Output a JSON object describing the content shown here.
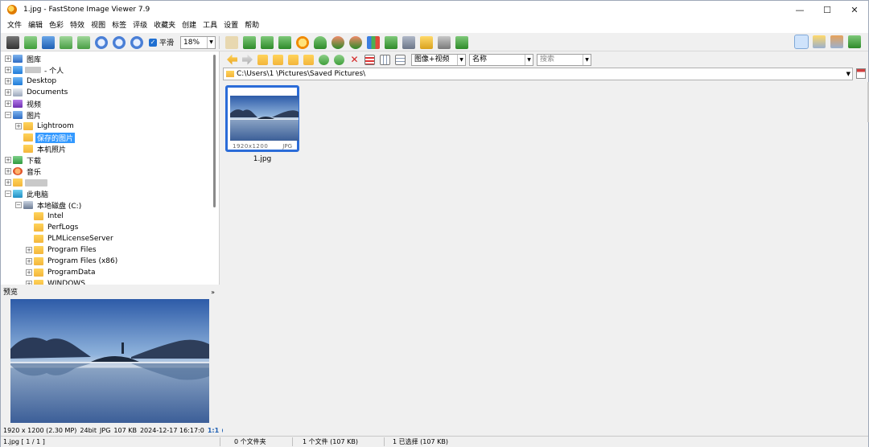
{
  "window": {
    "title": "1.jpg  -  FastStone Image Viewer 7.9",
    "controls": {
      "minimize": "—",
      "maximize": "☐",
      "close": "✕"
    }
  },
  "menu": [
    "文件",
    "编辑",
    "色彩",
    "特效",
    "视图",
    "标签",
    "评级",
    "收藏夹",
    "创建",
    "工具",
    "设置",
    "帮助"
  ],
  "toolbar": {
    "smooth_label": "平滑",
    "smooth_checked": true,
    "zoom_value": "18%",
    "icons": [
      "camera-icon",
      "open-folder-icon",
      "save-icon",
      "prev-image-icon",
      "next-image-icon",
      "zoom-in-icon",
      "zoom-out-icon",
      "actual-size-icon"
    ],
    "tools_icons": [
      "hand-tool-icon",
      "crop-icon",
      "resize-icon",
      "canvas-icon",
      "color-adjust-icon",
      "red-eye-icon",
      "rotate-left-icon",
      "rotate-right-icon",
      "histogram-icon",
      "slideshow-icon",
      "draw-icon",
      "email-icon",
      "print-icon",
      "checkmark-icon"
    ],
    "view_icons": [
      "thumbnail-view-icon",
      "detail-view-icon",
      "single-view-icon",
      "fullscreen-icon"
    ]
  },
  "tree": {
    "items": [
      {
        "label": "图库",
        "indent": 0,
        "expander": "+",
        "icon": "gallery-icon"
      },
      {
        "label": "- 个人",
        "indent": 0,
        "expander": "+",
        "icon": "onedrive-icon",
        "blurred_prefix": true
      },
      {
        "label": "Desktop",
        "indent": 0,
        "expander": "+",
        "icon": "desktop-icon"
      },
      {
        "label": "Documents",
        "indent": 0,
        "expander": "+",
        "icon": "documents-icon"
      },
      {
        "label": "视频",
        "indent": 0,
        "expander": "+",
        "icon": "videos-icon"
      },
      {
        "label": "图片",
        "indent": 0,
        "expander": "−",
        "icon": "pictures-icon"
      },
      {
        "label": "Lightroom",
        "indent": 1,
        "expander": "+",
        "icon": "folder-icon"
      },
      {
        "label": "保存的图片",
        "indent": 1,
        "expander": "",
        "icon": "folder-icon",
        "selected": true
      },
      {
        "label": "本机照片",
        "indent": 1,
        "expander": "",
        "icon": "folder-icon"
      },
      {
        "label": "下载",
        "indent": 0,
        "expander": "+",
        "icon": "downloads-icon"
      },
      {
        "label": "音乐",
        "indent": 0,
        "expander": "+",
        "icon": "music-icon"
      },
      {
        "label": "",
        "indent": 0,
        "expander": "+",
        "icon": "folder-icon",
        "blurred": true
      },
      {
        "label": "此电脑",
        "indent": 0,
        "expander": "−",
        "icon": "this-pc-icon"
      },
      {
        "label": "本地磁盘 (C:)",
        "indent": 1,
        "expander": "−",
        "icon": "drive-icon"
      },
      {
        "label": "Intel",
        "indent": 2,
        "expander": "",
        "icon": "folder-icon"
      },
      {
        "label": "PerfLogs",
        "indent": 2,
        "expander": "",
        "icon": "folder-icon"
      },
      {
        "label": "PLMLicenseServer",
        "indent": 2,
        "expander": "",
        "icon": "folder-icon"
      },
      {
        "label": "Program Files",
        "indent": 2,
        "expander": "+",
        "icon": "folder-icon"
      },
      {
        "label": "Program Files (x86)",
        "indent": 2,
        "expander": "+",
        "icon": "folder-icon"
      },
      {
        "label": "ProgramData",
        "indent": 2,
        "expander": "+",
        "icon": "folder-icon"
      },
      {
        "label": "WINDOWS",
        "indent": 2,
        "expander": "+",
        "icon": "folder-icon"
      }
    ]
  },
  "preview": {
    "header": "预览",
    "collapse_glyph": "»",
    "info": {
      "dimensions": "1920 x 1200 (2.30 MP)",
      "bitdepth": "24bit",
      "format": "JPG",
      "size": "107 KB",
      "datetime": "2024-12-17 16:17:0",
      "actual_size_label": "1:1"
    }
  },
  "browser": {
    "nav_icons": [
      "back-icon",
      "forward-icon",
      "up-folder-icon",
      "folder-icon",
      "new-folder-icon",
      "favorite-folder-icon",
      "refresh-icon",
      "copy-icon",
      "delete-icon",
      "thumbnails-icon",
      "grid-icon",
      "list-icon"
    ],
    "filter_value": "图像+视频",
    "sort_value": "名称",
    "search_placeholder": "搜索",
    "path": "C:\\Users\\1        \\Pictures\\Saved Pictures\\",
    "thumbnails": [
      {
        "name": "1.jpg",
        "dimensions": "1920x1200",
        "type": "JPG",
        "selected": true
      }
    ]
  },
  "status": {
    "current": "1.jpg [ 1 / 1 ]",
    "folders": "0 个文件夹",
    "files": "1 个文件 (107 KB)",
    "selected": "1 已选择 (107 KB)"
  },
  "colors": {
    "accent": "#2b6cd8",
    "selection": "#3399ff",
    "folder": "#f3b53b"
  }
}
